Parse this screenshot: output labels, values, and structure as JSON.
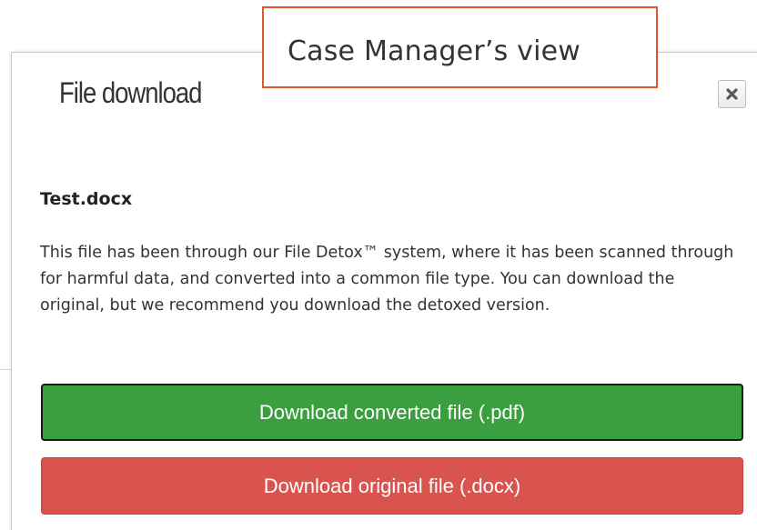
{
  "callout": {
    "text": "Case Manager’s view"
  },
  "dialog": {
    "title": "File download",
    "close_icon": "close-icon",
    "filename": "Test.docx",
    "description": "This file has been through our File Detox™ system, where it has been scanned through for harmful data, and converted into a common file type. You can download the original, but we recommend you download the detoxed version.",
    "buttons": {
      "converted": "Download converted file (.pdf)",
      "original": "Download original file (.docx)"
    }
  },
  "colors": {
    "callout_border": "#e2552a",
    "converted_button": "#3b9e3f",
    "original_button": "#d9534f"
  }
}
